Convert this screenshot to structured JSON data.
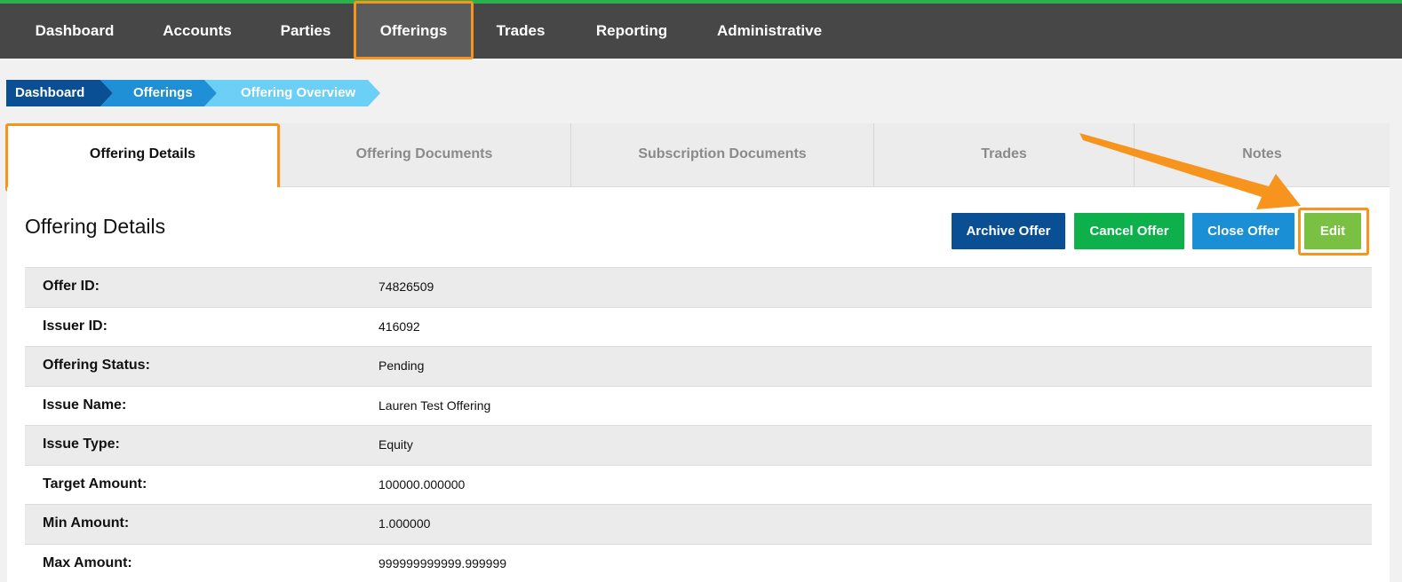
{
  "nav": {
    "items": [
      {
        "label": "Dashboard"
      },
      {
        "label": "Accounts"
      },
      {
        "label": "Parties"
      },
      {
        "label": "Offerings"
      },
      {
        "label": "Trades"
      },
      {
        "label": "Reporting"
      },
      {
        "label": "Administrative"
      }
    ],
    "active": "Offerings"
  },
  "breadcrumb": [
    {
      "label": "Dashboard",
      "color": "#0a4f94"
    },
    {
      "label": "Offerings",
      "color": "#1f8fd6"
    },
    {
      "label": "Offering Overview",
      "color": "#6ccff6"
    }
  ],
  "tabs": [
    {
      "label": "Offering Details"
    },
    {
      "label": "Offering Documents"
    },
    {
      "label": "Subscription Documents"
    },
    {
      "label": "Trades"
    },
    {
      "label": "Notes"
    }
  ],
  "panel": {
    "title": "Offering Details",
    "buttons": {
      "archive": {
        "label": "Archive Offer",
        "color": "#0a4f94"
      },
      "cancel": {
        "label": "Cancel Offer",
        "color": "#0db04b"
      },
      "close": {
        "label": "Close Offer",
        "color": "#1a8fd6"
      },
      "edit": {
        "label": "Edit",
        "color": "#7ac143"
      }
    }
  },
  "details": [
    {
      "key": "Offer ID:",
      "value": "74826509"
    },
    {
      "key": "Issuer ID:",
      "value": "416092"
    },
    {
      "key": "Offering Status:",
      "value": "Pending"
    },
    {
      "key": "Issue Name:",
      "value": "Lauren Test Offering"
    },
    {
      "key": "Issue Type:",
      "value": "Equity"
    },
    {
      "key": "Target Amount:",
      "value": "100000.000000"
    },
    {
      "key": "Min Amount:",
      "value": "1.000000"
    },
    {
      "key": "Max Amount:",
      "value": "999999999999.999999"
    }
  ],
  "colors": {
    "highlight": "#f7941d",
    "nav_bg": "#474747",
    "nav_accent": "#2bb24c"
  }
}
